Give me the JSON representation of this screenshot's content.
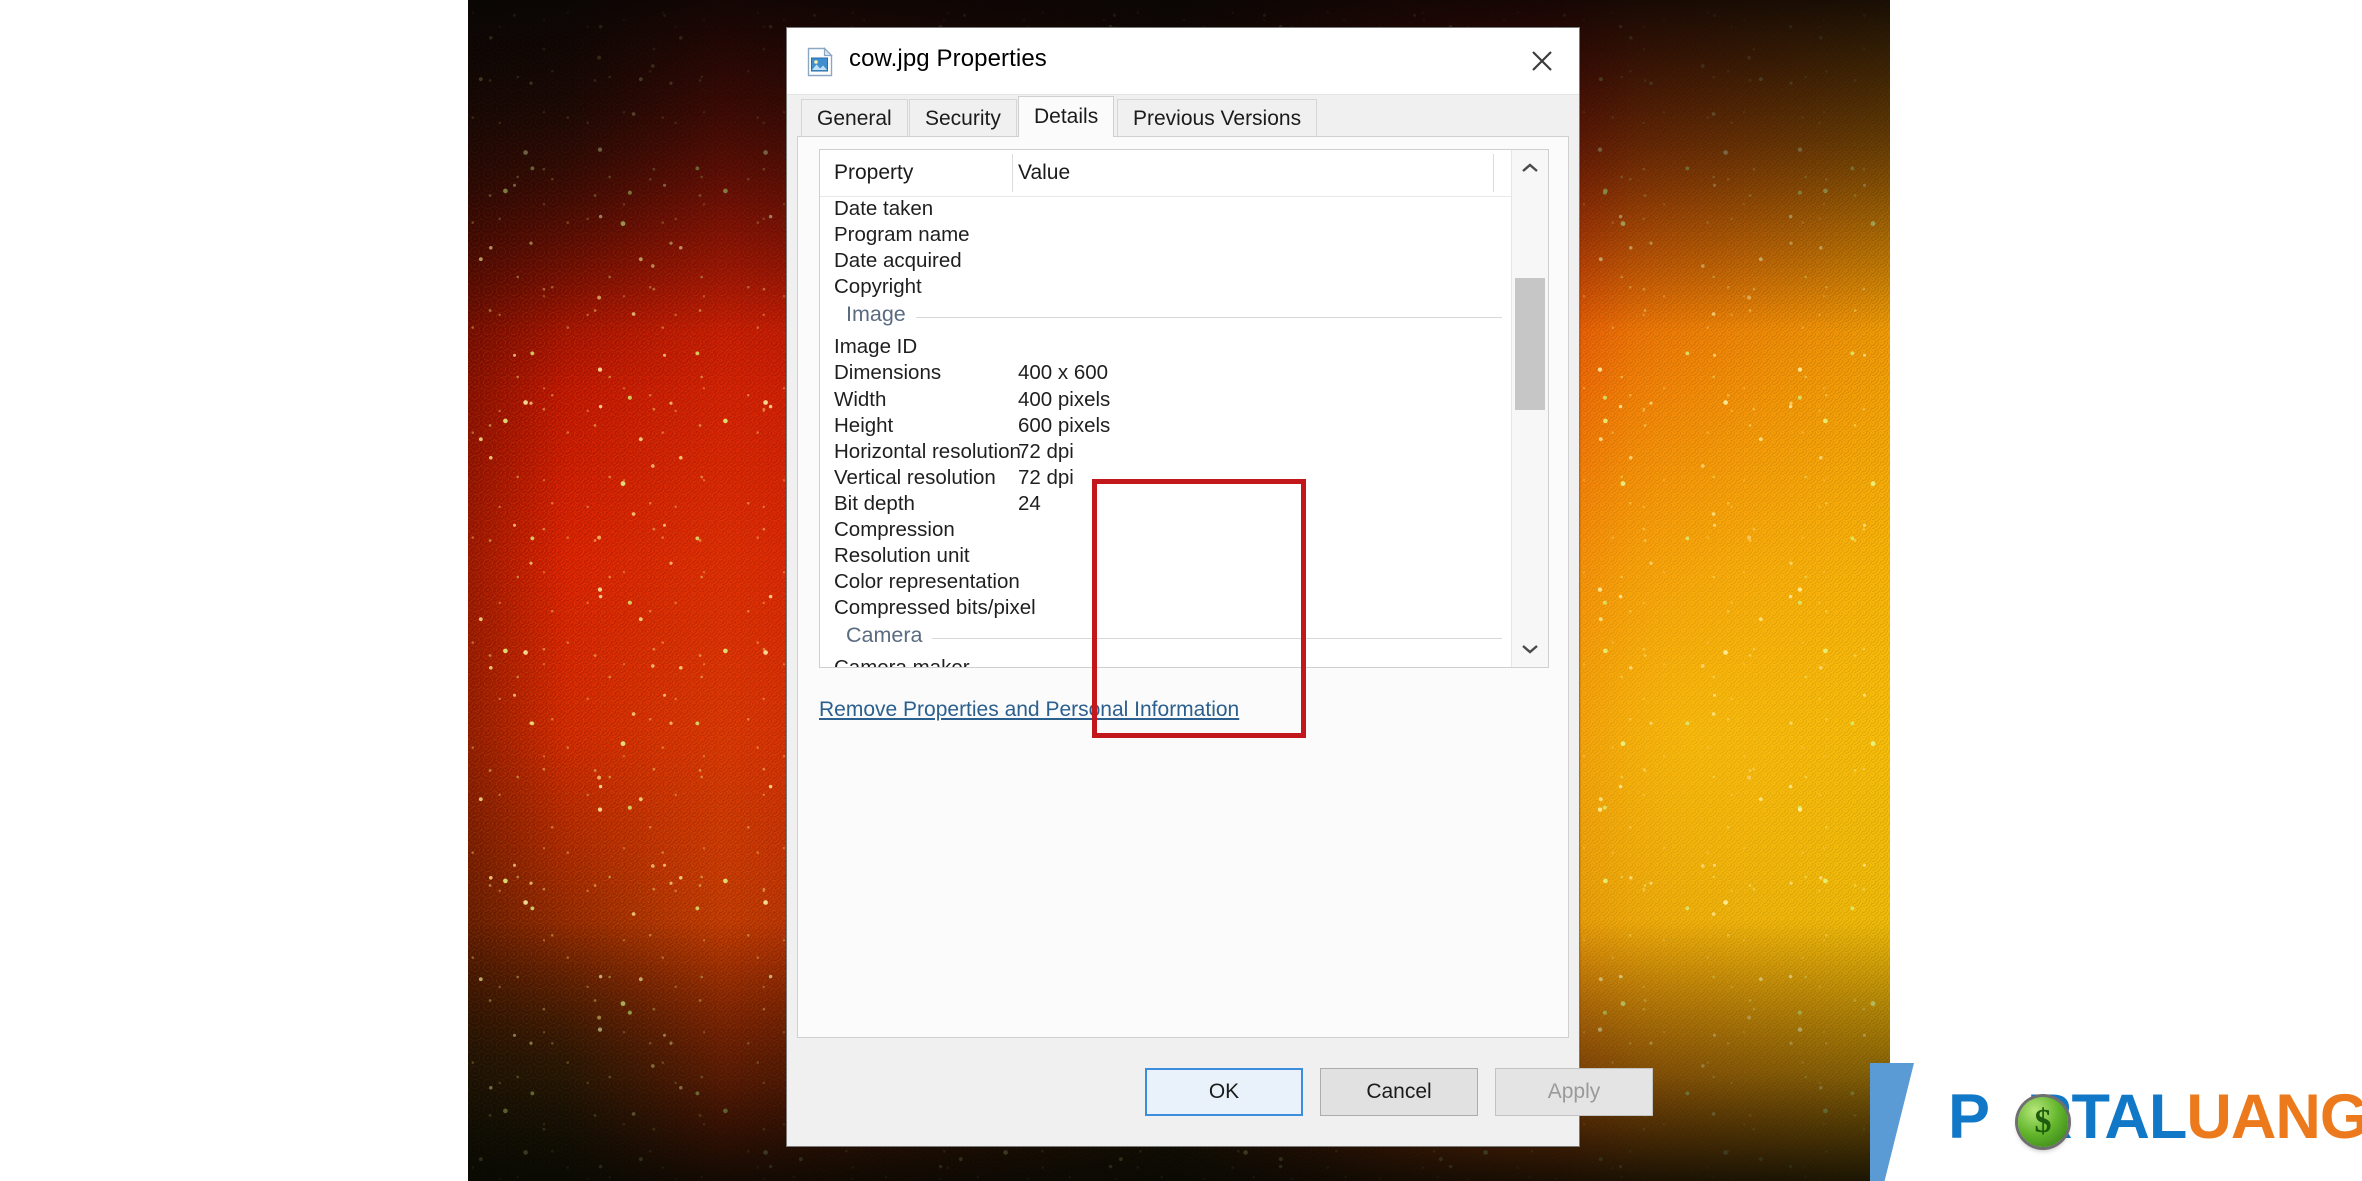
{
  "window": {
    "title": "cow.jpg Properties",
    "icon": "image-file-icon",
    "close_label": "×"
  },
  "tabs": [
    {
      "label": "General",
      "active": false
    },
    {
      "label": "Security",
      "active": false
    },
    {
      "label": "Details",
      "active": true
    },
    {
      "label": "Previous Versions",
      "active": false
    }
  ],
  "details": {
    "columns": {
      "property": "Property",
      "value": "Value"
    },
    "rows": [
      {
        "type": "row",
        "name": "Date taken",
        "value": ""
      },
      {
        "type": "row",
        "name": "Program name",
        "value": ""
      },
      {
        "type": "row",
        "name": "Date acquired",
        "value": ""
      },
      {
        "type": "row",
        "name": "Copyright",
        "value": ""
      },
      {
        "type": "section",
        "name": "Image",
        "value": ""
      },
      {
        "type": "row",
        "name": "Image ID",
        "value": ""
      },
      {
        "type": "row",
        "name": "Dimensions",
        "value": "400 x 600"
      },
      {
        "type": "row",
        "name": "Width",
        "value": "400 pixels"
      },
      {
        "type": "row",
        "name": "Height",
        "value": "600 pixels"
      },
      {
        "type": "row",
        "name": "Horizontal resolution",
        "value": "72 dpi"
      },
      {
        "type": "row",
        "name": "Vertical resolution",
        "value": "72 dpi"
      },
      {
        "type": "row",
        "name": "Bit depth",
        "value": "24"
      },
      {
        "type": "row",
        "name": "Compression",
        "value": ""
      },
      {
        "type": "row",
        "name": "Resolution unit",
        "value": ""
      },
      {
        "type": "row",
        "name": "Color representation",
        "value": ""
      },
      {
        "type": "row",
        "name": "Compressed bits/pixel",
        "value": ""
      },
      {
        "type": "section",
        "name": "Camera",
        "value": ""
      },
      {
        "type": "row",
        "name": "Camera maker",
        "value": ""
      }
    ],
    "scrollbar": {
      "up_icon": "chevron-up-icon",
      "down_icon": "chevron-down-icon"
    },
    "highlight": {
      "color": "#c2181b",
      "covers": [
        "Dimensions",
        "Width",
        "Height",
        "Horizontal resolution",
        "Vertical resolution",
        "Bit depth"
      ]
    }
  },
  "remove_link": {
    "label": "Remove Properties and Personal Information"
  },
  "footer": {
    "ok": "OK",
    "cancel": "Cancel",
    "apply": "Apply",
    "apply_disabled": true
  },
  "logo": {
    "part1": "P",
    "part2": "RTAL",
    "part3": "UANG",
    "coin_symbol": "$",
    "blue": "#1178c8",
    "orange": "#ec7a1c"
  }
}
